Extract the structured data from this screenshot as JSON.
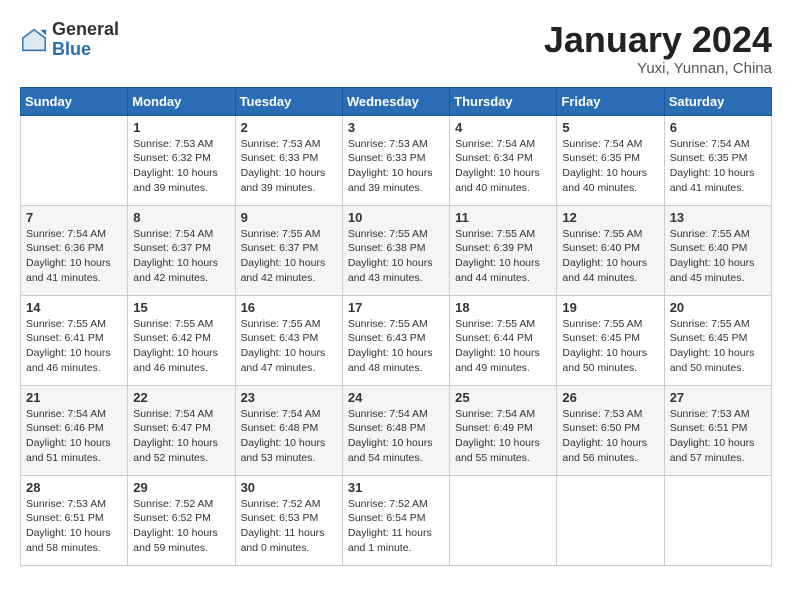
{
  "header": {
    "logo_general": "General",
    "logo_blue": "Blue",
    "month_title": "January 2024",
    "location": "Yuxi, Yunnan, China"
  },
  "days_of_week": [
    "Sunday",
    "Monday",
    "Tuesday",
    "Wednesday",
    "Thursday",
    "Friday",
    "Saturday"
  ],
  "weeks": [
    [
      {
        "day": "",
        "info": ""
      },
      {
        "day": "1",
        "info": "Sunrise: 7:53 AM\nSunset: 6:32 PM\nDaylight: 10 hours\nand 39 minutes."
      },
      {
        "day": "2",
        "info": "Sunrise: 7:53 AM\nSunset: 6:33 PM\nDaylight: 10 hours\nand 39 minutes."
      },
      {
        "day": "3",
        "info": "Sunrise: 7:53 AM\nSunset: 6:33 PM\nDaylight: 10 hours\nand 39 minutes."
      },
      {
        "day": "4",
        "info": "Sunrise: 7:54 AM\nSunset: 6:34 PM\nDaylight: 10 hours\nand 40 minutes."
      },
      {
        "day": "5",
        "info": "Sunrise: 7:54 AM\nSunset: 6:35 PM\nDaylight: 10 hours\nand 40 minutes."
      },
      {
        "day": "6",
        "info": "Sunrise: 7:54 AM\nSunset: 6:35 PM\nDaylight: 10 hours\nand 41 minutes."
      }
    ],
    [
      {
        "day": "7",
        "info": "Sunrise: 7:54 AM\nSunset: 6:36 PM\nDaylight: 10 hours\nand 41 minutes."
      },
      {
        "day": "8",
        "info": "Sunrise: 7:54 AM\nSunset: 6:37 PM\nDaylight: 10 hours\nand 42 minutes."
      },
      {
        "day": "9",
        "info": "Sunrise: 7:55 AM\nSunset: 6:37 PM\nDaylight: 10 hours\nand 42 minutes."
      },
      {
        "day": "10",
        "info": "Sunrise: 7:55 AM\nSunset: 6:38 PM\nDaylight: 10 hours\nand 43 minutes."
      },
      {
        "day": "11",
        "info": "Sunrise: 7:55 AM\nSunset: 6:39 PM\nDaylight: 10 hours\nand 44 minutes."
      },
      {
        "day": "12",
        "info": "Sunrise: 7:55 AM\nSunset: 6:40 PM\nDaylight: 10 hours\nand 44 minutes."
      },
      {
        "day": "13",
        "info": "Sunrise: 7:55 AM\nSunset: 6:40 PM\nDaylight: 10 hours\nand 45 minutes."
      }
    ],
    [
      {
        "day": "14",
        "info": "Sunrise: 7:55 AM\nSunset: 6:41 PM\nDaylight: 10 hours\nand 46 minutes."
      },
      {
        "day": "15",
        "info": "Sunrise: 7:55 AM\nSunset: 6:42 PM\nDaylight: 10 hours\nand 46 minutes."
      },
      {
        "day": "16",
        "info": "Sunrise: 7:55 AM\nSunset: 6:43 PM\nDaylight: 10 hours\nand 47 minutes."
      },
      {
        "day": "17",
        "info": "Sunrise: 7:55 AM\nSunset: 6:43 PM\nDaylight: 10 hours\nand 48 minutes."
      },
      {
        "day": "18",
        "info": "Sunrise: 7:55 AM\nSunset: 6:44 PM\nDaylight: 10 hours\nand 49 minutes."
      },
      {
        "day": "19",
        "info": "Sunrise: 7:55 AM\nSunset: 6:45 PM\nDaylight: 10 hours\nand 50 minutes."
      },
      {
        "day": "20",
        "info": "Sunrise: 7:55 AM\nSunset: 6:45 PM\nDaylight: 10 hours\nand 50 minutes."
      }
    ],
    [
      {
        "day": "21",
        "info": "Sunrise: 7:54 AM\nSunset: 6:46 PM\nDaylight: 10 hours\nand 51 minutes."
      },
      {
        "day": "22",
        "info": "Sunrise: 7:54 AM\nSunset: 6:47 PM\nDaylight: 10 hours\nand 52 minutes."
      },
      {
        "day": "23",
        "info": "Sunrise: 7:54 AM\nSunset: 6:48 PM\nDaylight: 10 hours\nand 53 minutes."
      },
      {
        "day": "24",
        "info": "Sunrise: 7:54 AM\nSunset: 6:48 PM\nDaylight: 10 hours\nand 54 minutes."
      },
      {
        "day": "25",
        "info": "Sunrise: 7:54 AM\nSunset: 6:49 PM\nDaylight: 10 hours\nand 55 minutes."
      },
      {
        "day": "26",
        "info": "Sunrise: 7:53 AM\nSunset: 6:50 PM\nDaylight: 10 hours\nand 56 minutes."
      },
      {
        "day": "27",
        "info": "Sunrise: 7:53 AM\nSunset: 6:51 PM\nDaylight: 10 hours\nand 57 minutes."
      }
    ],
    [
      {
        "day": "28",
        "info": "Sunrise: 7:53 AM\nSunset: 6:51 PM\nDaylight: 10 hours\nand 58 minutes."
      },
      {
        "day": "29",
        "info": "Sunrise: 7:52 AM\nSunset: 6:52 PM\nDaylight: 10 hours\nand 59 minutes."
      },
      {
        "day": "30",
        "info": "Sunrise: 7:52 AM\nSunset: 6:53 PM\nDaylight: 11 hours\nand 0 minutes."
      },
      {
        "day": "31",
        "info": "Sunrise: 7:52 AM\nSunset: 6:54 PM\nDaylight: 11 hours\nand 1 minute."
      },
      {
        "day": "",
        "info": ""
      },
      {
        "day": "",
        "info": ""
      },
      {
        "day": "",
        "info": ""
      }
    ]
  ]
}
